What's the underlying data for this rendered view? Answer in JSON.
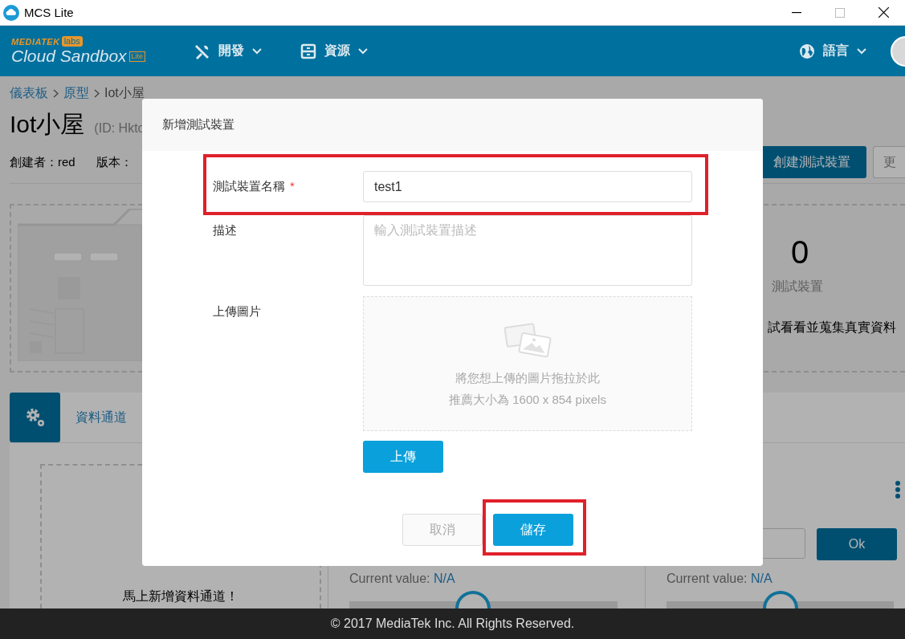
{
  "window": {
    "title": "MCS Lite"
  },
  "navbar": {
    "logo_brand": "MEDIATEK",
    "logo_labs": "labs",
    "logo_product": "Cloud Sandbox",
    "logo_badge": "Lite",
    "menus": [
      {
        "label": "開發",
        "kind": "tools"
      },
      {
        "label": "資源",
        "kind": "archive"
      }
    ],
    "language": "語言"
  },
  "breadcrumb": [
    {
      "label": "儀表板",
      "kind": "link"
    },
    {
      "label": "原型",
      "kind": "link"
    },
    {
      "label": "Iot小屋",
      "kind": "current"
    }
  ],
  "prototype": {
    "name": "Iot小屋",
    "id": "(ID: Hkto",
    "creator": "創建者：red",
    "version": "版本：",
    "create_button": "創建測試裝置",
    "more_button": "更"
  },
  "summary": {
    "count": "0",
    "count_label": "測試裝置",
    "hint": "試看看並蒐集真實資料"
  },
  "section_tab": {
    "label": "資料通道"
  },
  "channels": {
    "empty_hint": "馬上新增資料通道！",
    "cards": [
      {
        "kind": "slider",
        "current_label": "Current value:",
        "current_value": "N/A",
        "level": 0.46
      },
      {
        "kind": "control",
        "button": "Ok",
        "current_label": "Current value:",
        "current_value": "N/A",
        "level": 0.5
      }
    ]
  },
  "modal": {
    "title": "新增測試裝置",
    "fields": [
      {
        "kind": "text",
        "label": "測試裝置名稱",
        "required_mark": "*",
        "value": "test1",
        "highlighted": true
      },
      {
        "kind": "textarea",
        "label": "描述",
        "placeholder": "輸入測試裝置描述",
        "highlighted": false
      },
      {
        "kind": "upload",
        "label": "上傳圖片",
        "drop_text": "將您想上傳的圖片拖拉於此",
        "size_hint": "推薦大小為 1600 x 854 pixels",
        "button": "上傳",
        "highlighted": false
      }
    ],
    "actions": [
      {
        "label": "取消",
        "kind": "cancel",
        "disabled": true,
        "highlighted": false
      },
      {
        "label": "儲存",
        "kind": "primary",
        "disabled": false,
        "highlighted": true
      }
    ]
  },
  "footer": "© 2017 MediaTek Inc. All Rights Reserved."
}
